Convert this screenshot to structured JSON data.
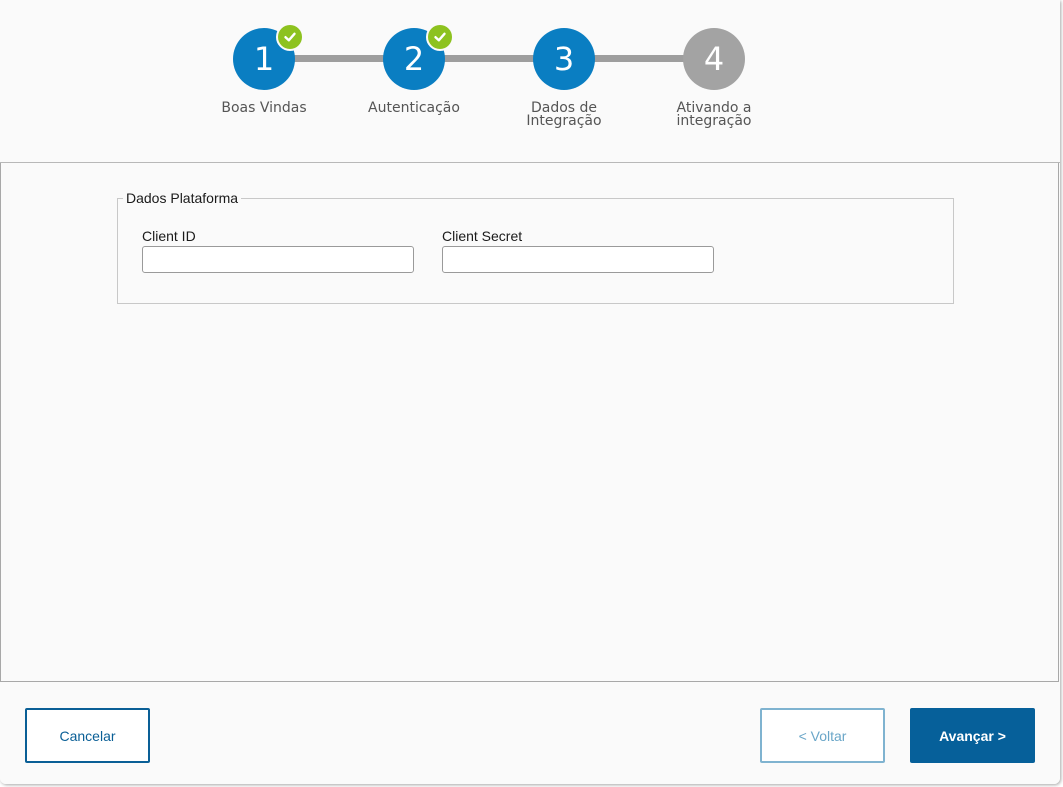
{
  "stepper": {
    "steps": [
      {
        "number": "1",
        "label_line1": "Boas Vindas",
        "label_line2": "",
        "state": "completed"
      },
      {
        "number": "2",
        "label_line1": "Autenticação",
        "label_line2": "",
        "state": "completed"
      },
      {
        "number": "3",
        "label_line1": "Dados de",
        "label_line2": "Integração",
        "state": "active"
      },
      {
        "number": "4",
        "label_line1": "Ativando a",
        "label_line2": "integração",
        "state": "pending"
      }
    ],
    "colors": {
      "active": "#0a7ec2",
      "pending": "#a3a3a3",
      "connector": "#9e9e9e",
      "check": "#8dc21f"
    }
  },
  "form": {
    "legend": "Dados Plataforma",
    "client_id": {
      "label": "Client ID",
      "value": "",
      "placeholder": ""
    },
    "client_secret": {
      "label": "Client Secret",
      "value": "",
      "placeholder": ""
    }
  },
  "footer": {
    "cancel_label": "Cancelar",
    "back_label": "< Voltar",
    "next_label": "Avançar >"
  }
}
